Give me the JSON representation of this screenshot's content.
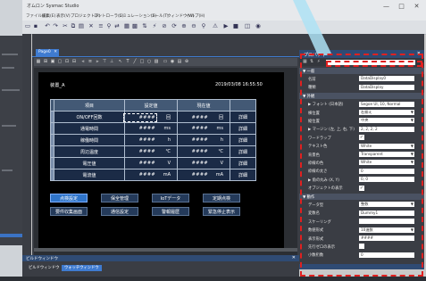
{
  "window": {
    "title": "オムロン Sysmac Studio",
    "controls": [
      "—",
      "□",
      "✕"
    ]
  },
  "menubar": {
    "items": [
      "ファイル(F)",
      "編集(E)",
      "表示(V)",
      "プロジェクト(P)",
      "コントローラ(C)",
      "シミュレーション(S)",
      "ツール(T)",
      "ウィンドウ(W)",
      "ヘルプ(H)"
    ]
  },
  "editor": {
    "tab_label": "Page0",
    "page_title": "装置_A",
    "datetime": "2019/03/08 16:55:50",
    "table": {
      "headers": [
        "項目",
        "設定値",
        "現在値",
        ""
      ],
      "rows": [
        {
          "label": "ON/OFF回数",
          "set": "####",
          "set_unit": "回",
          "cur": "####",
          "cur_unit": "回",
          "action": "詳細"
        },
        {
          "label": "通電時間",
          "set": "####",
          "set_unit": "ms",
          "cur": "####",
          "cur_unit": "ms",
          "action": "詳細"
        },
        {
          "label": "稼働時間",
          "set": "####",
          "set_unit": "h",
          "cur": "####",
          "cur_unit": "h",
          "action": "詳細"
        },
        {
          "label": "周辺温度",
          "set": "####",
          "set_unit": "℃",
          "cur": "####",
          "cur_unit": "℃",
          "action": "詳細"
        },
        {
          "label": "電圧値",
          "set": "####",
          "set_unit": "V",
          "cur": "####",
          "cur_unit": "V",
          "action": "詳細"
        },
        {
          "label": "電流値",
          "set": "####",
          "set_unit": "mA",
          "cur": "####",
          "cur_unit": "mA",
          "action": "詳細"
        }
      ]
    },
    "nav_buttons": [
      {
        "label": "点検設定",
        "active": true
      },
      {
        "label": "保全管理",
        "active": false
      },
      {
        "label": "IoTデータ",
        "active": false
      },
      {
        "label": "定期点検",
        "active": false
      },
      {
        "label": "要件収集画面",
        "active": false
      },
      {
        "label": "通信設定",
        "active": false
      },
      {
        "label": "警報履歴",
        "active": false
      },
      {
        "label": "緊急停止表示",
        "active": false
      }
    ]
  },
  "properties": {
    "title": "プロパティ",
    "rows": [
      {
        "type": "cat",
        "label": "▼ 一般"
      },
      {
        "type": "field",
        "label": "名前",
        "value": "DataDisplay0"
      },
      {
        "type": "field",
        "label": "種類",
        "value": "DataDisplay"
      },
      {
        "type": "cat",
        "label": "▼ 外観"
      },
      {
        "type": "field",
        "label": "▶ フォント (日本語)",
        "value": "Segoe UI, 10, Normal"
      },
      {
        "type": "dd",
        "label": "横位置",
        "value": "右揃え"
      },
      {
        "type": "dd",
        "label": "縦位置",
        "value": "中央"
      },
      {
        "type": "field",
        "label": "▶ マージン (左, 上, 右, 下)",
        "value": "2, 2, 2, 2"
      },
      {
        "type": "chk",
        "label": "ワードラップ",
        "value": "✓"
      },
      {
        "type": "dd",
        "label": "テキスト色",
        "value": "White"
      },
      {
        "type": "dd",
        "label": "背景色",
        "value": "Transparent"
      },
      {
        "type": "dd",
        "label": "枠線の色",
        "value": "White"
      },
      {
        "type": "field",
        "label": "枠線の太さ",
        "value": "0"
      },
      {
        "type": "field",
        "label": "▶ 角の丸み (X, Y)",
        "value": "0, 0"
      },
      {
        "type": "chk",
        "label": "オブジェクトの表示",
        "value": "✓"
      },
      {
        "type": "cat",
        "label": "▼ 動作"
      },
      {
        "type": "dd",
        "label": "データ型",
        "value": "整数"
      },
      {
        "type": "field",
        "label": "変数名",
        "value": "Dummy1"
      },
      {
        "type": "field",
        "label": "スケーリング",
        "value": ""
      },
      {
        "type": "dd",
        "label": "数値形式",
        "value": "10進数"
      },
      {
        "type": "field",
        "label": "表示形式",
        "value": "####"
      },
      {
        "type": "chk",
        "label": "先行ゼロの表示",
        "value": ""
      },
      {
        "type": "field",
        "label": "小数桁数",
        "value": "0"
      }
    ]
  },
  "bottom_panel": {
    "title": "ビルドウィンドウ",
    "tabs": [
      {
        "label": "ビルドウィンドウ",
        "active": false
      },
      {
        "label": "ウォッチウィンドウ",
        "active": true
      }
    ]
  },
  "colors": {
    "accent": "#3f7bd0",
    "highlight": "#e02020",
    "table_cell": "#1b2b46"
  }
}
